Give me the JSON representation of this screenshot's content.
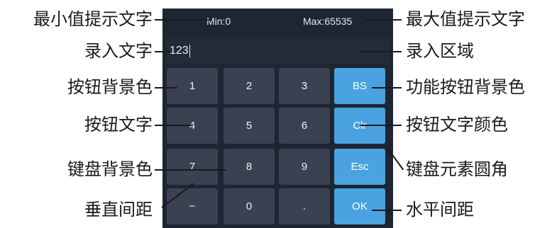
{
  "annotations": {
    "min_text": "最小值提示文字",
    "input_text": "录入文字",
    "button_bg": "按钮背景色",
    "button_text": "按钮文字",
    "keyboard_bg": "键盘背景色",
    "vertical_spacing": "垂直间距",
    "max_text": "最大值提示文字",
    "input_area": "录入区域",
    "fn_button_bg": "功能按钮背景色",
    "button_text_color": "按钮文字颜色",
    "corner_radius": "键盘元素圆角",
    "horizontal_spacing": "水平间距"
  },
  "keyboard": {
    "min_label": "Min:0",
    "max_label": "Max:65535",
    "input_value": "123",
    "keys": {
      "k1": "1",
      "k2": "2",
      "k3": "3",
      "bs": "BS",
      "k4": "4",
      "k5": "5",
      "k6": "6",
      "clr": "Clr",
      "k7": "7",
      "k8": "8",
      "k9": "9",
      "esc": "Esc",
      "minus": "−",
      "k0": "0",
      "dot": ".",
      "ok": "OK"
    }
  },
  "colors": {
    "panel_bg": "#1e2533",
    "key_bg": "#3a4251",
    "fn_key_bg": "#4aa3e0",
    "text": "#f1f3f6"
  }
}
